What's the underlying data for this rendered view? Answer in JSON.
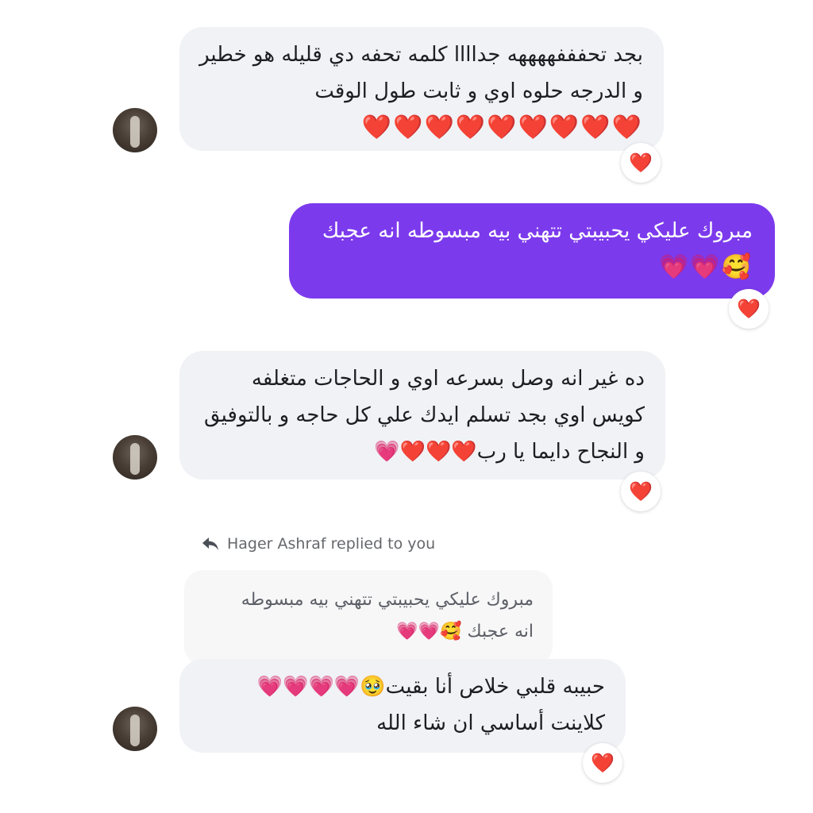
{
  "messages": [
    {
      "lines": [
        "بجد تحفففههههه جداااا كلمه تحفه دي قليله هو خطير",
        "و الدرجه حلوه اوي و ثابت طول الوقت"
      ],
      "emoji": "❤️❤️❤️❤️❤️❤️❤️❤️❤️",
      "reaction": "❤️"
    },
    {
      "lines": [
        "مبروك عليكي يحبيبتي تتهني بيه مبسوطه انه عجبك"
      ],
      "emoji": "🥰💗💗",
      "reaction": "❤️"
    },
    {
      "lines": [
        "ده غير انه وصل بسرعه اوي و الحاجات متغلفه",
        "كويس اوي بجد تسلم ايدك علي كل حاجه و بالتوفيق",
        "و النجاح دايما يا رب❤️❤️❤️💗"
      ],
      "reaction": "❤️"
    }
  ],
  "reply": {
    "label": "Hager Ashraf replied to you",
    "quoted_lines": [
      "مبروك عليكي يحبيبتي تتهني بيه مبسوطه",
      "انه عجبك 🥰💗💗"
    ],
    "lines": [
      "حبيبه قلبي خلاص أنا بقيت🥹💗💗💗💗",
      "كلاينت أساسي ان شاء الله"
    ],
    "reaction": "❤️"
  }
}
